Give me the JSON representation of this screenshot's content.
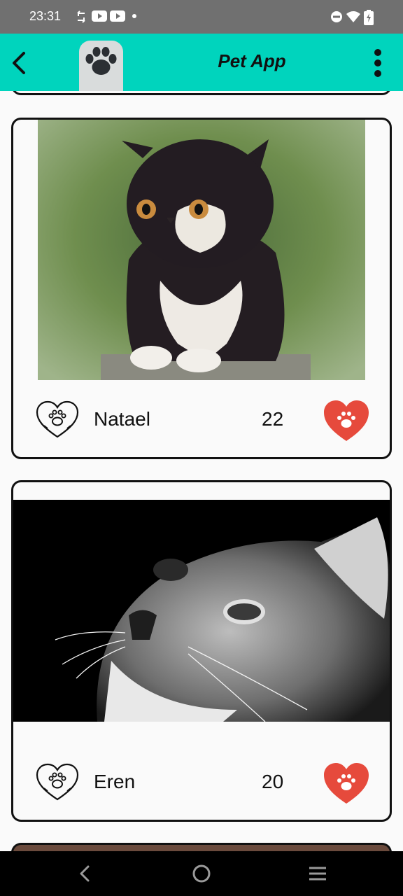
{
  "status_bar": {
    "time": "23:31",
    "icons": [
      "sync-icon",
      "youtube-icon",
      "youtube-icon",
      "dot-icon",
      "do-not-disturb-icon",
      "wifi-icon",
      "battery-charging-icon"
    ]
  },
  "app_bar": {
    "title": "Pet App",
    "back_icon": "chevron-left-icon",
    "logo_icon": "paw-icon",
    "menu_icon": "more-vertical-icon"
  },
  "pets": [
    {
      "name": "Natael",
      "age": "22",
      "photo": "black-white-kitten-photo",
      "liked": true
    },
    {
      "name": "Eren",
      "age": "20",
      "photo": "grey-tabby-cat-photo",
      "liked": true
    }
  ],
  "colors": {
    "app_bar": "#00d4bd",
    "status_bar": "#707070",
    "like_red": "#e64a3c",
    "card_border": "#111111"
  },
  "nav_bar": {
    "icons": [
      "back-nav-icon",
      "home-nav-icon",
      "recents-nav-icon"
    ]
  }
}
